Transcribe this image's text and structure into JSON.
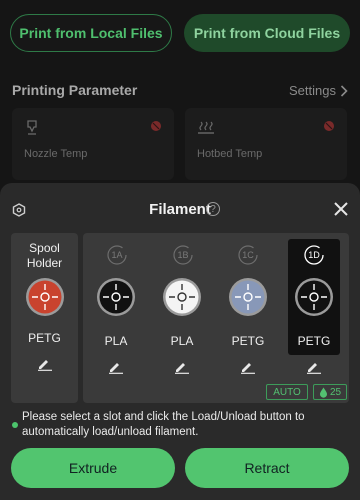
{
  "top": {
    "local_button": "Print from Local Files",
    "cloud_button": "Print from Cloud Files"
  },
  "printing": {
    "section_title": "Printing Parameter",
    "settings_link": "Settings",
    "nozzle_label": "Nozzle Temp",
    "hotbed_label": "Hotbed Temp"
  },
  "filament": {
    "title": "Filament",
    "help_glyph": "?",
    "spool": {
      "title_line1": "Spool",
      "title_line2": "Holder",
      "material": "PETG",
      "color": "#c9432e"
    },
    "slots": [
      {
        "label": "1A",
        "material": "PLA",
        "color": "#111111",
        "selected": false
      },
      {
        "label": "1B",
        "material": "PLA",
        "color": "#f4f4f4",
        "selected": false
      },
      {
        "label": "1C",
        "material": "PETG",
        "color": "#8898b8",
        "selected": false
      },
      {
        "label": "1D",
        "material": "PETG",
        "color": "#111111",
        "selected": true
      }
    ],
    "auto_badge": "AUTO",
    "humidity_value": "25",
    "info_text": "Please select a slot and click the Load/Unload button to automatically load/unload filament.",
    "extrude_button": "Extrude",
    "retract_button": "Retract"
  },
  "colors": {
    "accent_green": "#52c56f",
    "warn_red": "#7a2a2a"
  }
}
